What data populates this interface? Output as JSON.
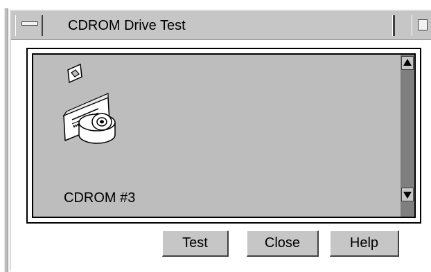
{
  "window": {
    "title": "CDROM Drive Test"
  },
  "device": {
    "label": "CDROM #3",
    "icon": "cdrom-drive-icon"
  },
  "buttons": {
    "test_label": "Test",
    "close_label": "Close",
    "help_label": "Help"
  },
  "colors": {
    "chrome": "#c6c6c6",
    "panel": "#bdbdbd",
    "scroll_trough": "#7f7f7f"
  }
}
